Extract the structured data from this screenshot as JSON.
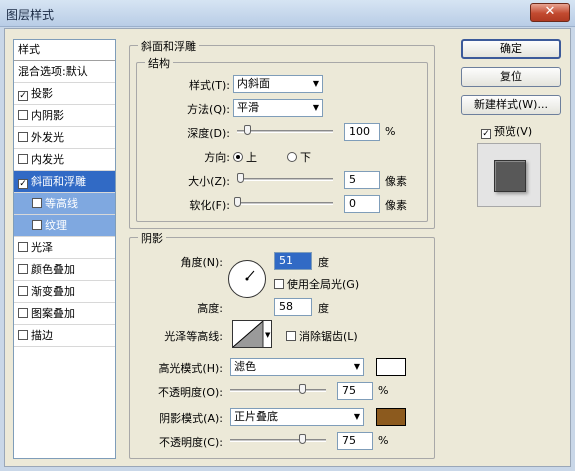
{
  "window": {
    "title": "图层样式",
    "close_label": "✕"
  },
  "style_list": {
    "header": "样式",
    "blend_label": "混合选项:默认",
    "items": [
      {
        "label": "投影",
        "checked": true
      },
      {
        "label": "内阴影",
        "checked": false
      },
      {
        "label": "外发光",
        "checked": false
      },
      {
        "label": "内发光",
        "checked": false
      },
      {
        "label": "斜面和浮雕",
        "checked": true
      },
      {
        "label": "等高线",
        "checked": false
      },
      {
        "label": "纹理",
        "checked": false
      },
      {
        "label": "光泽",
        "checked": false
      },
      {
        "label": "颜色叠加",
        "checked": false
      },
      {
        "label": "渐变叠加",
        "checked": false
      },
      {
        "label": "图案叠加",
        "checked": false
      },
      {
        "label": "描边",
        "checked": false
      }
    ]
  },
  "bevel": {
    "group_title": "斜面和浮雕",
    "structure_title": "结构",
    "style_label": "样式(T):",
    "style_value": "内斜面",
    "method_label": "方法(Q):",
    "method_value": "平滑",
    "depth_label": "深度(D):",
    "depth_value": "100",
    "depth_unit": "%",
    "depth_level": 0.1,
    "direction_label": "方向:",
    "direction_up": "上",
    "direction_down": "下",
    "size_label": "大小(Z):",
    "size_value": "5",
    "size_unit": "像素",
    "size_level": 0.03,
    "soften_label": "软化(F):",
    "soften_value": "0",
    "soften_unit": "像素",
    "soften_level": 0.0
  },
  "shading": {
    "group_title": "阴影",
    "angle_label": "角度(N):",
    "angle_value": "51",
    "angle_unit": "度",
    "global_light_label": "使用全局光(G)",
    "altitude_label": "高度:",
    "altitude_value": "58",
    "altitude_unit": "度",
    "gloss_label": "光泽等高线:",
    "antialias_label": "消除锯齿(L)",
    "highlight_mode_label": "高光模式(H):",
    "highlight_mode_value": "滤色",
    "highlight_color": "#ffffff",
    "highlight_opacity_label": "不透明度(O):",
    "highlight_opacity_value": "75",
    "highlight_opacity_unit": "%",
    "highlight_opacity_level": 0.75,
    "shadow_mode_label": "阴影模式(A):",
    "shadow_mode_value": "正片叠底",
    "shadow_color": "#8c5a1e",
    "shadow_opacity_label": "不透明度(C):",
    "shadow_opacity_value": "75",
    "shadow_opacity_unit": "%",
    "shadow_opacity_level": 0.75
  },
  "buttons": {
    "ok": "确定",
    "reset": "复位",
    "new_style": "新建样式(W)...",
    "preview": "预览(V)"
  }
}
